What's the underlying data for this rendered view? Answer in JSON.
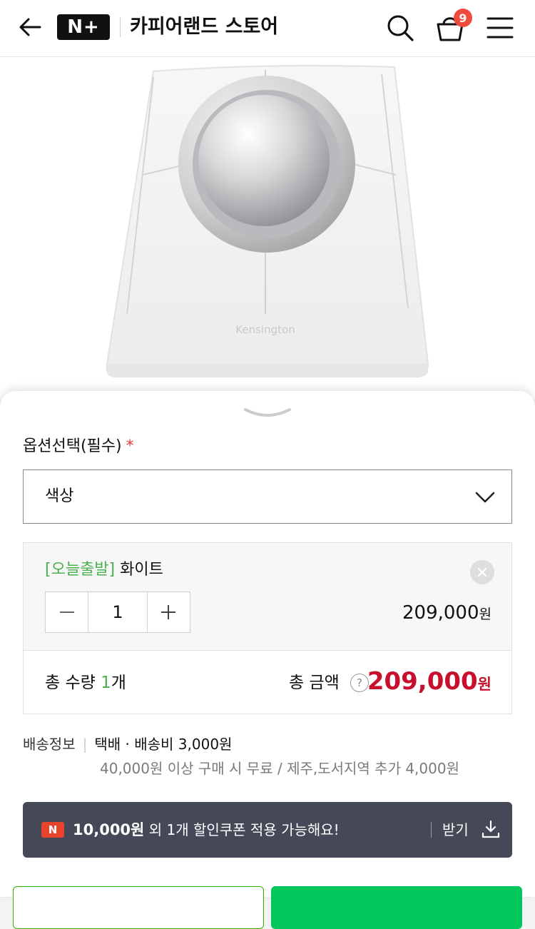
{
  "header": {
    "logo": "N+",
    "store_name": "카피어랜드 스토어",
    "cart_count": "9"
  },
  "product": {
    "brand_mark": "Kensington"
  },
  "option": {
    "label": "옵션선택(필수)",
    "required_mark": "*",
    "select_value": "색상"
  },
  "selected_item": {
    "tag": "[오늘출발]",
    "name": "화이트",
    "quantity": "1",
    "price": "209,000",
    "price_unit": "원"
  },
  "total": {
    "qty_prefix": "총 수량",
    "qty_value": "1",
    "qty_unit": "개",
    "amount_label": "총 금액",
    "help_icon": "?",
    "amount": "209,000",
    "amount_unit": "원"
  },
  "shipping": {
    "label": "배송정보",
    "method": "택배 · 배송비 3,000원",
    "note": "40,000원 이상 구매 시 무료 / 제주,도서지역 추가 4,000원"
  },
  "coupon": {
    "badge": "N",
    "amount": "10,000원",
    "text": " 외 1개 할인쿠폰 적용 가능해요!",
    "action": "받기"
  },
  "colors": {
    "accent_green": "#03c75a",
    "price_red": "#c8102e",
    "badge_red": "#f04a3a",
    "coupon_bg": "#444857"
  }
}
